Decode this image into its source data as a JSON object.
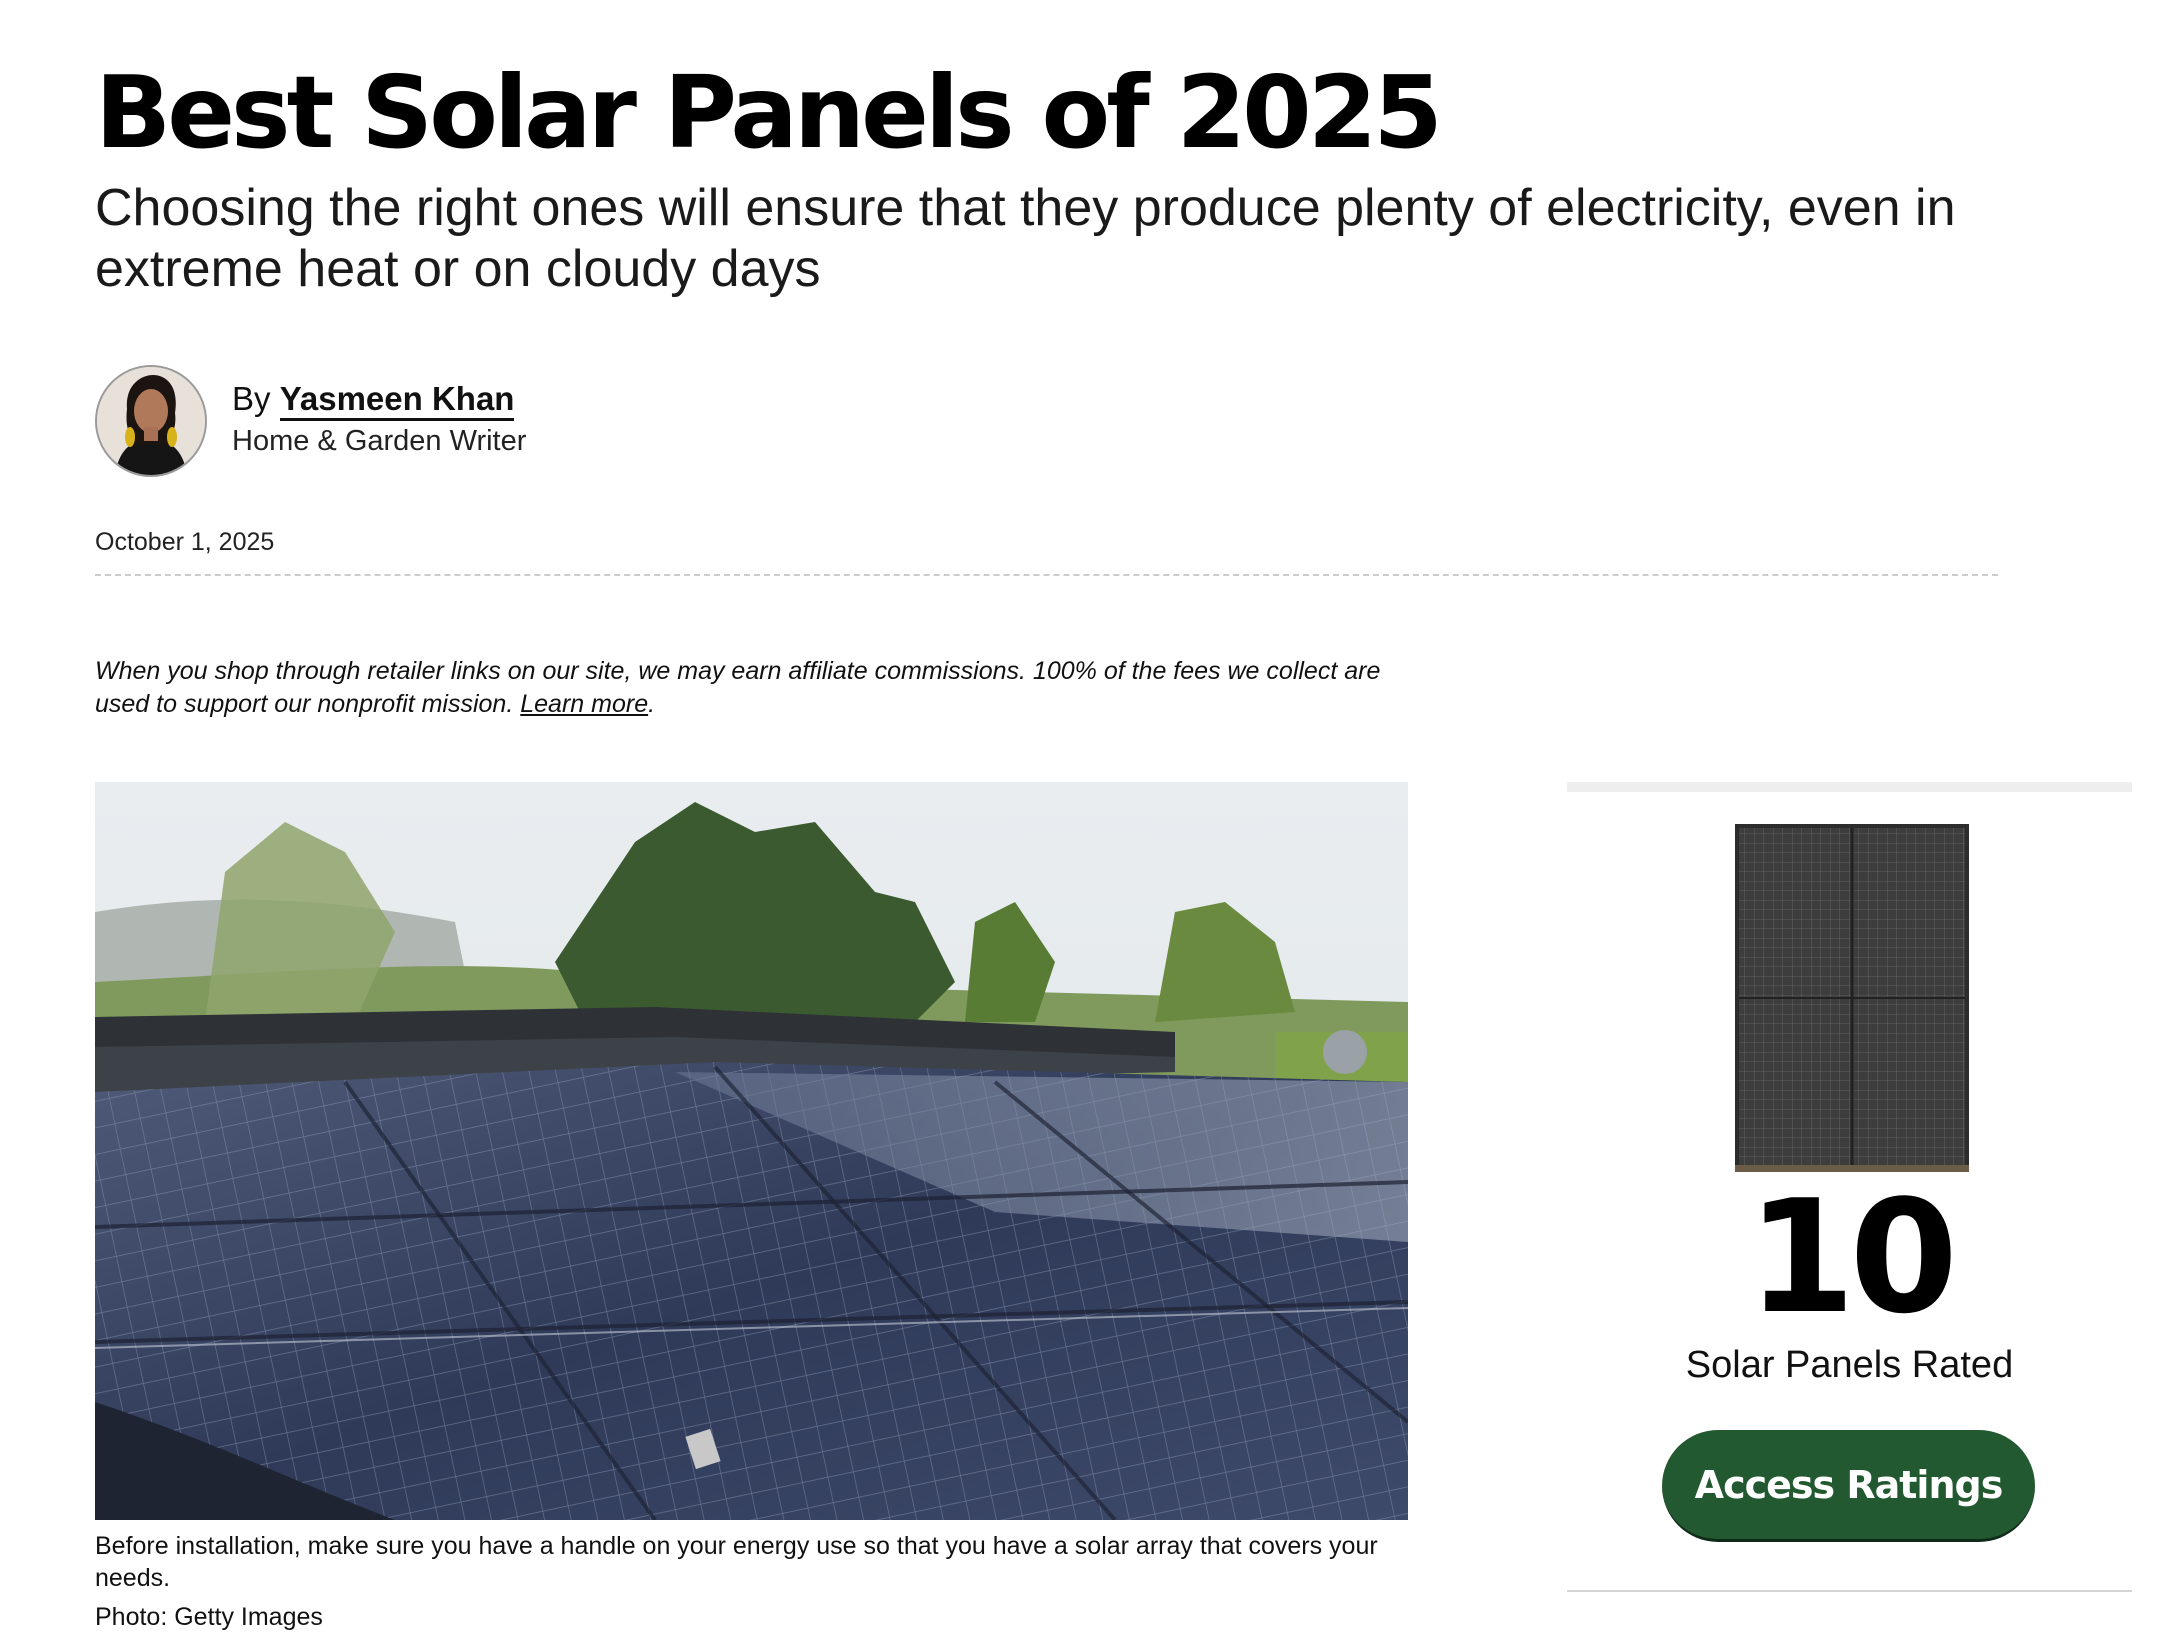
{
  "article": {
    "title": "Best Solar Panels of 2025",
    "subtitle": "Choosing the right ones will ensure that they produce plenty of electricity, even in extreme heat or on cloudy days",
    "author": {
      "by_label": "By",
      "name": "Yasmeen Khan",
      "role": "Home & Garden Writer"
    },
    "date": "October 1, 2025",
    "affiliate": {
      "text": "When you shop through retailer links on our site, we may earn affiliate commissions. 100% of the fees we collect are used to support our nonprofit mission.",
      "link": "Learn more",
      "end": "."
    },
    "hero": {
      "caption": "Before installation, make sure you have a handle on your energy use so that you have a solar array that covers your needs.",
      "credit": "Photo: Getty Images"
    }
  },
  "sidebar": {
    "count": "10",
    "count_label": "Solar Panels Rated",
    "cta_label": "Access Ratings"
  },
  "colors": {
    "cta_green": "#235930",
    "text": "#111111",
    "divider": "#cccccc"
  },
  "icons": {
    "avatar": "author-portrait",
    "panel": "solar-panel-product-image"
  }
}
